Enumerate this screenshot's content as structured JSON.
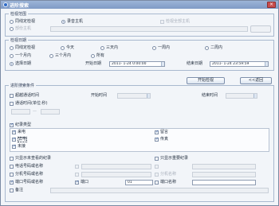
{
  "window": {
    "title": "进阶搜索",
    "close_label": "×"
  },
  "search_scope": {
    "legend": "检视范围",
    "option_same_station": "同线定检视",
    "option_same_host": "录音主机",
    "option_check_all": "检视全部主机",
    "option_partial": "部份主机"
  },
  "search_date": {
    "legend": "检视日期",
    "row1": [
      "同线定检视",
      "今天",
      "三天内",
      "一周内",
      "二周内"
    ],
    "row2": [
      "一个月内",
      "三个月内",
      "所有"
    ],
    "select_date_label": "选择日期",
    "start_date_label": "开始日期",
    "start_date_value": "2011- 1-24  0:00:00",
    "end_date_label": "结束日期",
    "end_date_value": "2011- 1-24 23:59:59"
  },
  "buttons": {
    "start_search": "开始检视",
    "back": "<<返回"
  },
  "conditions": {
    "legend": "进阶搜索条件",
    "exceed_call_time": "超越通话时间",
    "start_time_label": "开始时间",
    "end_time_label": "结束时间",
    "call_duration_label": "通话时间(单位:秒)",
    "call_duration_dash": "—",
    "record_type_label": "纪录类型",
    "type_incoming": "来电",
    "type_outgoing": "去电",
    "type_missed": "未接",
    "type_voicemail": "留言",
    "type_fax": "传真",
    "only_unread": "只显示未查看的纪录",
    "only_important": "只显示重要纪录",
    "phone_name": "电话号码或名称",
    "remark": "备注",
    "ext_name": "分机号码或名称",
    "ext_name_right": "分机名称",
    "port_name": "端口号码或名称",
    "port_label": "端口",
    "port_value": "01",
    "port_name_right": "端口名称",
    "remark_bottom": "备注"
  },
  "colors": {
    "accent": "#1d4f9e",
    "title_bar": "#7f9ac5",
    "window_bg": "#f2f5f9"
  }
}
